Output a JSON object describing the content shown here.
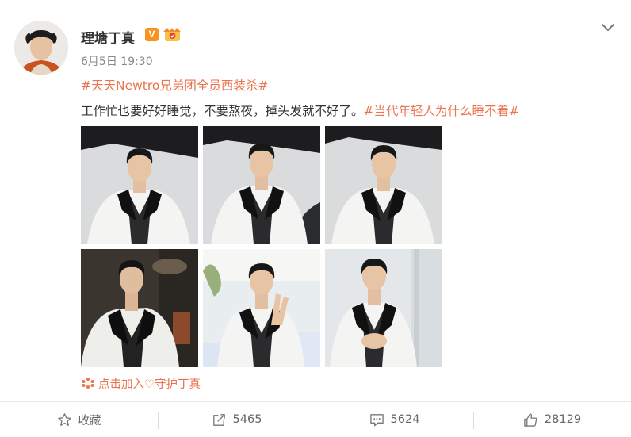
{
  "post": {
    "username": "理塘丁真",
    "vip_badge": "V",
    "timestamp": "6月5日 19:30",
    "line1_hashtag": "#天天Newtro兄弟团全员西装杀#",
    "line2_text": "工作忙也要好好睡觉，不要熬夜，掉头发就不好了。",
    "line2_hashtag": "#当代年轻人为什么睡不着#",
    "guard_label": "点击加入♡守护丁真"
  },
  "actions": [
    {
      "label": "收藏",
      "icon": "star-icon"
    },
    {
      "label": "5465",
      "icon": "share-icon"
    },
    {
      "label": "5624",
      "icon": "comment-icon"
    },
    {
      "label": "28129",
      "icon": "thumbs-up-icon"
    }
  ],
  "colors": {
    "hashtag": "#eb7350",
    "meta": "#888888",
    "vip": "#f7931e"
  }
}
